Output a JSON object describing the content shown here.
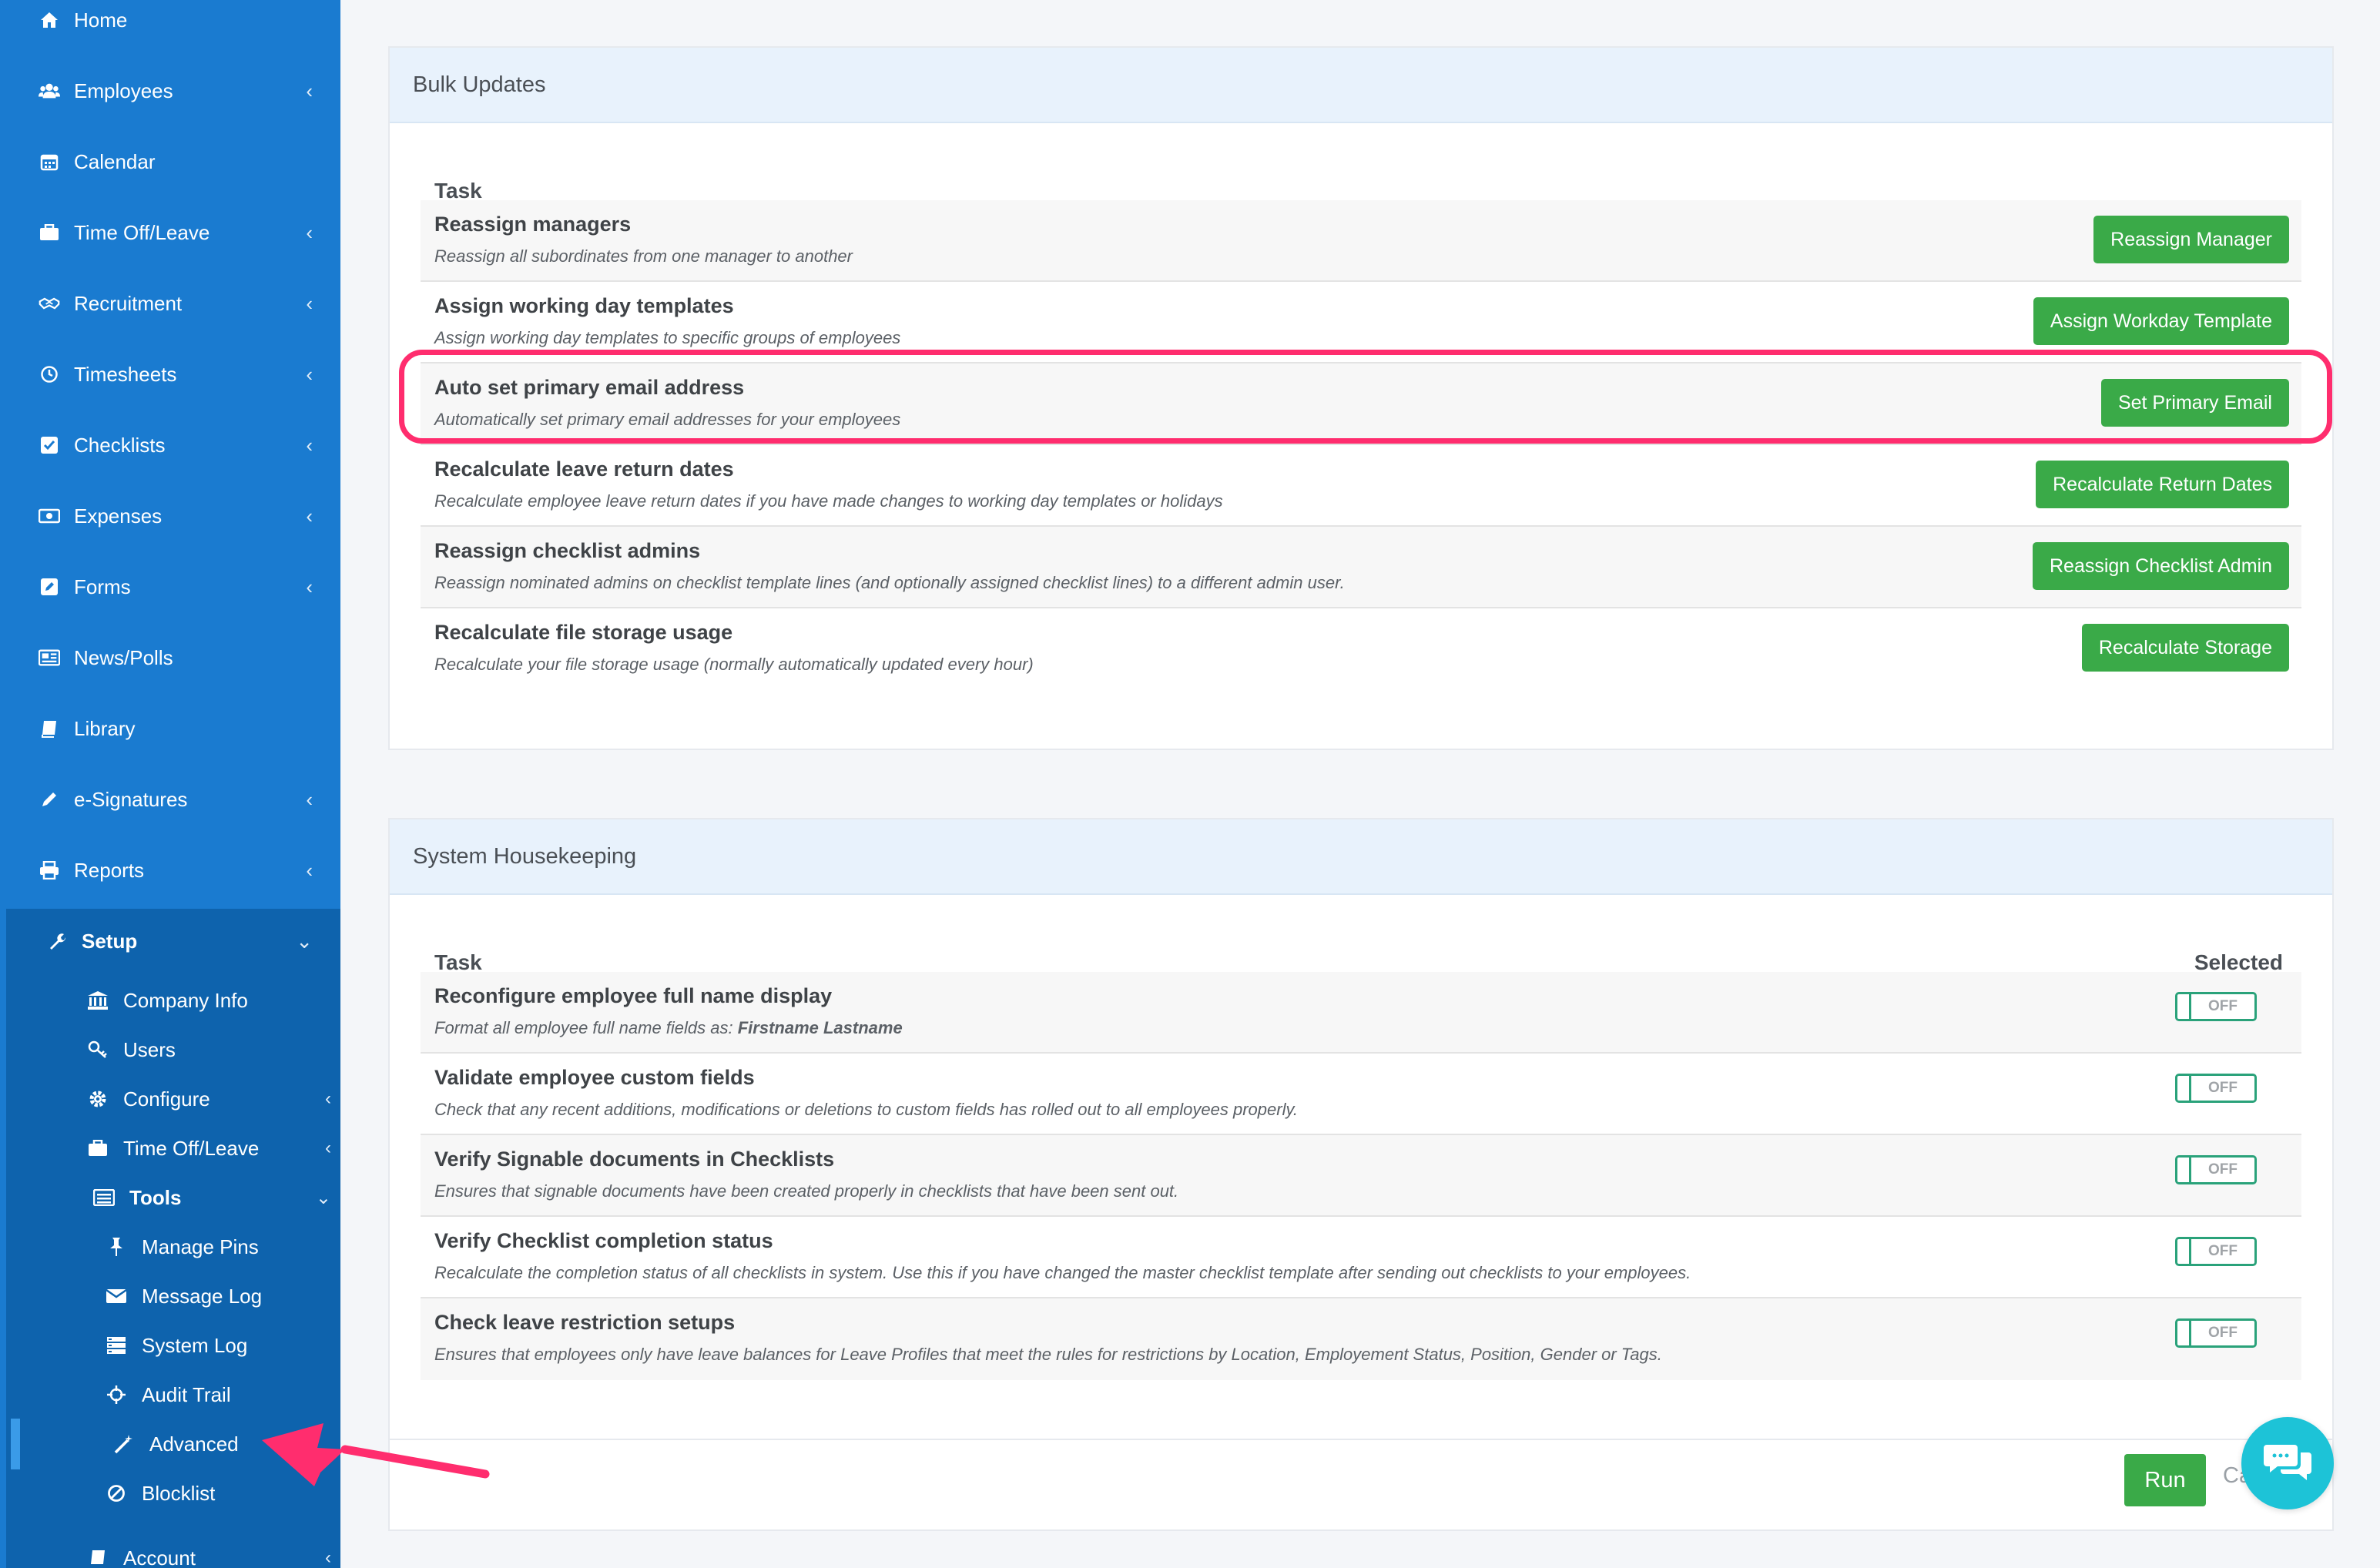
{
  "sidebar": {
    "items": [
      {
        "label": "Home",
        "icon": "home-icon",
        "chevron": false
      },
      {
        "label": "Employees",
        "icon": "users-icon",
        "chevron": true
      },
      {
        "label": "Calendar",
        "icon": "calendar-icon",
        "chevron": false
      },
      {
        "label": "Time Off/Leave",
        "icon": "briefcase-icon",
        "chevron": true
      },
      {
        "label": "Recruitment",
        "icon": "handshake-icon",
        "chevron": true
      },
      {
        "label": "Timesheets",
        "icon": "clock-icon",
        "chevron": true
      },
      {
        "label": "Checklists",
        "icon": "checkbox-icon",
        "chevron": true
      },
      {
        "label": "Expenses",
        "icon": "money-icon",
        "chevron": true
      },
      {
        "label": "Forms",
        "icon": "edit-icon",
        "chevron": true
      },
      {
        "label": "News/Polls",
        "icon": "newspaper-icon",
        "chevron": false
      },
      {
        "label": "Library",
        "icon": "book-icon",
        "chevron": false
      },
      {
        "label": "e-Signatures",
        "icon": "pen-icon",
        "chevron": true
      },
      {
        "label": "Reports",
        "icon": "printer-icon",
        "chevron": true
      }
    ],
    "setup": {
      "label": "Setup",
      "items": [
        {
          "label": "Company Info",
          "icon": "bank-icon"
        },
        {
          "label": "Users",
          "icon": "key-icon"
        },
        {
          "label": "Configure",
          "icon": "gear-icon"
        },
        {
          "label": "Time Off/Leave",
          "icon": "briefcase-icon"
        },
        {
          "label": "Tools",
          "icon": "list-icon"
        }
      ],
      "tools": [
        {
          "label": "Manage Pins",
          "icon": "pin-icon"
        },
        {
          "label": "Message Log",
          "icon": "envelope-icon"
        },
        {
          "label": "System Log",
          "icon": "server-icon"
        },
        {
          "label": "Audit Trail",
          "icon": "crosshair-icon"
        },
        {
          "label": "Advanced",
          "icon": "magic-wand-icon"
        },
        {
          "label": "Blocklist",
          "icon": "ban-icon"
        }
      ],
      "account_label": "Account"
    }
  },
  "bulk_updates": {
    "title": "Bulk Updates",
    "task_header": "Task",
    "rows": [
      {
        "title": "Reassign managers",
        "desc": "Reassign all subordinates from one manager to another",
        "button": "Reassign Manager"
      },
      {
        "title": "Assign working day templates",
        "desc": "Assign working day templates to specific groups of employees",
        "button": "Assign Workday Template"
      },
      {
        "title": "Auto set primary email address",
        "desc": "Automatically set primary email addresses for your employees",
        "button": "Set Primary Email"
      },
      {
        "title": "Recalculate leave return dates",
        "desc": "Recalculate employee leave return dates if you have made changes to working day templates or holidays",
        "button": "Recalculate Return Dates"
      },
      {
        "title": "Reassign checklist admins",
        "desc": "Reassign nominated admins on checklist template lines (and optionally assigned checklist lines) to a different admin user.",
        "button": "Reassign Checklist Admin"
      },
      {
        "title": "Recalculate file storage usage",
        "desc": "Recalculate your file storage usage (normally automatically updated every hour)",
        "button": "Recalculate Storage"
      }
    ]
  },
  "housekeeping": {
    "title": "System Housekeeping",
    "task_header": "Task",
    "selected_header": "Selected",
    "rows": [
      {
        "title": "Reconfigure employee full name display",
        "desc": "Format all employee full name fields as: ",
        "desc_bold": "Firstname Lastname",
        "toggle": "OFF"
      },
      {
        "title": "Validate employee custom fields",
        "desc": "Check that any recent additions, modifications or deletions to custom fields has rolled out to all employees properly.",
        "toggle": "OFF"
      },
      {
        "title": "Verify Signable documents in Checklists",
        "desc": "Ensures that signable documents have been created properly in checklists that have been sent out.",
        "toggle": "OFF"
      },
      {
        "title": "Verify Checklist completion status",
        "desc": "Recalculate the completion status of all checklists in system. Use this if you have changed the master checklist template after sending out checklists to your employees.",
        "toggle": "OFF"
      },
      {
        "title": "Check leave restriction setups",
        "desc": "Ensures that employees only have leave balances for Leave Profiles that meet the rules for restrictions by Location, Employement Status, Position, Gender or Tags.",
        "toggle": "OFF"
      }
    ],
    "run_label": "Run",
    "cancel_label": "Ca"
  },
  "colors": {
    "sidebar": "#1a7bd0",
    "sidebar_sub": "#0e63ad",
    "button_green": "#3aaa48",
    "highlight": "#ff2d6e",
    "chat": "#1dc3d7"
  }
}
